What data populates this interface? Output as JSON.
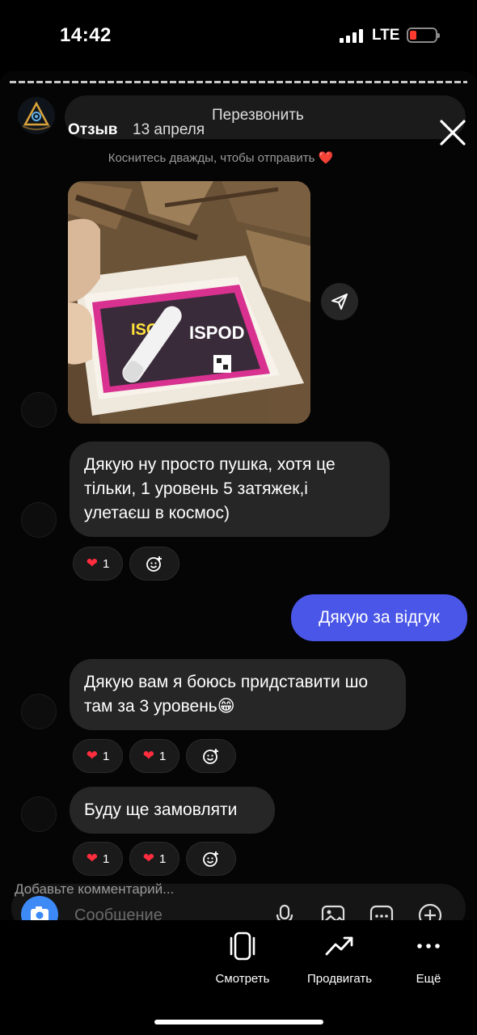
{
  "status_bar": {
    "time": "14:42",
    "network": "LTE",
    "battery_level": 0.15,
    "battery_color": "#ff3b30"
  },
  "story": {
    "username": "Отзыв",
    "date": "13 апреля",
    "top_label": "Перезвонить",
    "double_tap_hint": "Коснитесь дважды, чтобы отправить",
    "hint_heart": "❤️",
    "photo_text": {
      "brand1": "ISO",
      "brand2": "ISPOD"
    }
  },
  "messages": [
    {
      "direction": "in",
      "text": "Дякую  ну просто пушка, хотя це тільки, 1 уровень 5 затяжек,і улетаєш в космос)"
    },
    {
      "direction": "out",
      "text": "Дякую за відгук"
    },
    {
      "direction": "in",
      "text": "Дякую вам я боюсь придставити шо там за 3 уровень😁"
    },
    {
      "direction": "in",
      "text": "Буду ще замовляти"
    }
  ],
  "reactions": {
    "heart_count": "1",
    "heart_symbol": "❤",
    "add_emoji_icon": "add-reaction-icon"
  },
  "comment": {
    "placeholder": "Добавьте комментарий...",
    "message_placeholder": "Сообщение"
  },
  "actions": {
    "view": "Смотреть",
    "promote": "Продвигать",
    "more": "Ещё"
  },
  "colors": {
    "accent": "#4a56e8",
    "bubble_in": "#262626",
    "like": "#ff2d3d",
    "camera": "#3d8af7"
  }
}
